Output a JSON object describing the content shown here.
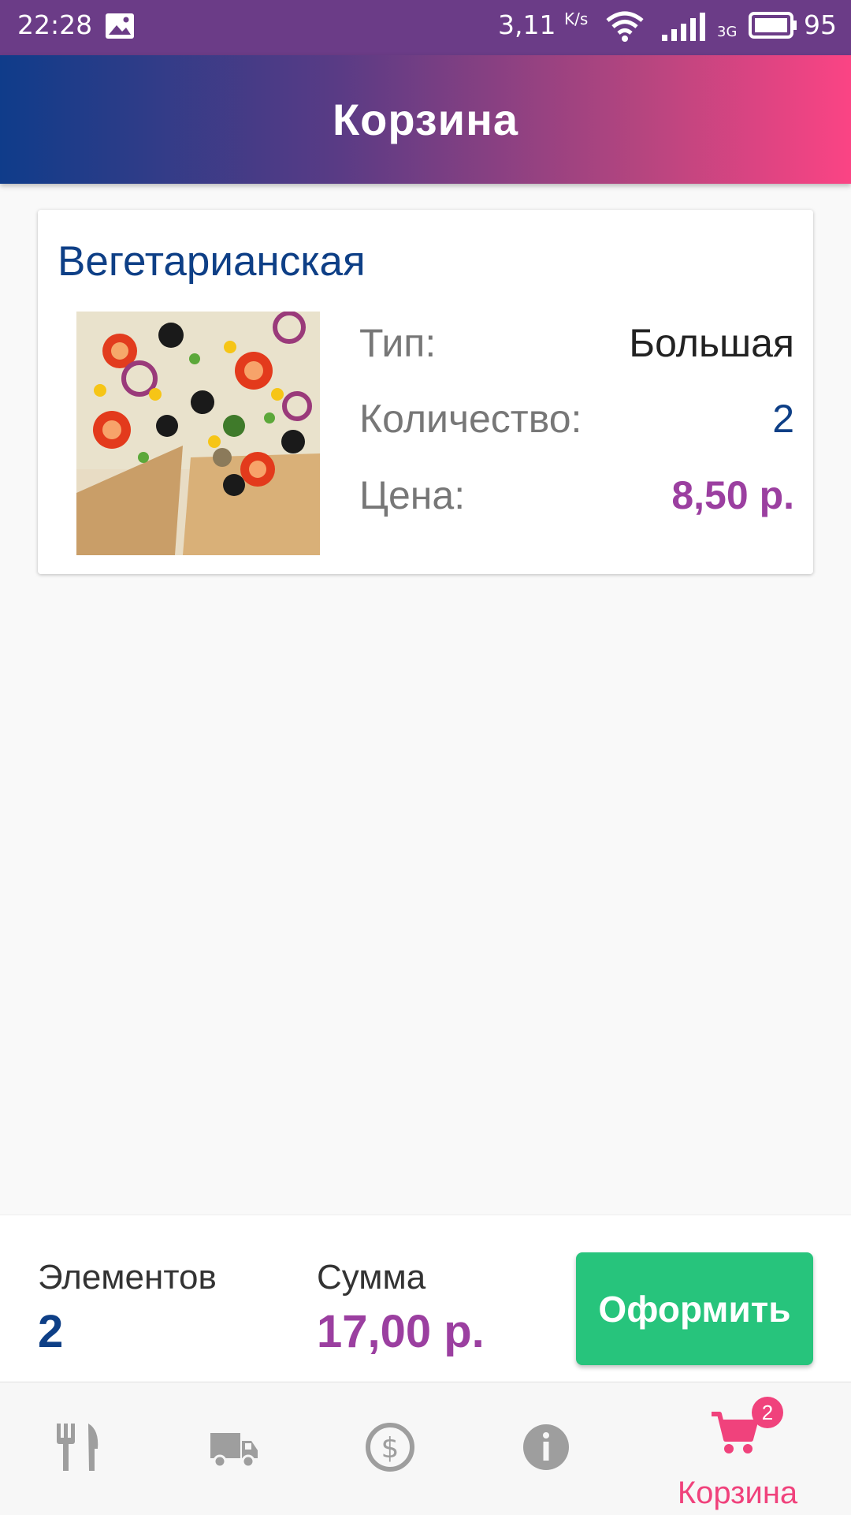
{
  "status_bar": {
    "time": "22:28",
    "speed": "3,11",
    "speed_unit": "K/s",
    "network": "3G",
    "battery": "95"
  },
  "app_bar": {
    "title": "Корзина"
  },
  "cart_item": {
    "name": "Вегетарианская",
    "type_label": "Тип:",
    "type_value": "Большая",
    "quantity_label": "Количество:",
    "quantity_value": "2",
    "price_label": "Цена:",
    "price_value": "8,50 р."
  },
  "summary": {
    "items_label": "Элементов",
    "items_value": "2",
    "total_label": "Сумма",
    "total_value": "17,00 р.",
    "checkout_label": "Оформить"
  },
  "bottom_nav": {
    "items": [
      {
        "icon": "fork-knife-icon"
      },
      {
        "icon": "truck-icon"
      },
      {
        "icon": "dollar-icon"
      },
      {
        "icon": "info-icon"
      },
      {
        "icon": "cart-icon",
        "label": "Корзина",
        "badge": "2",
        "active": true
      }
    ]
  },
  "colors": {
    "brand_blue": "#0e3f86",
    "brand_purple": "#9b3fa0",
    "accent_pink": "#f0427c",
    "checkout_green": "#27c47c"
  }
}
